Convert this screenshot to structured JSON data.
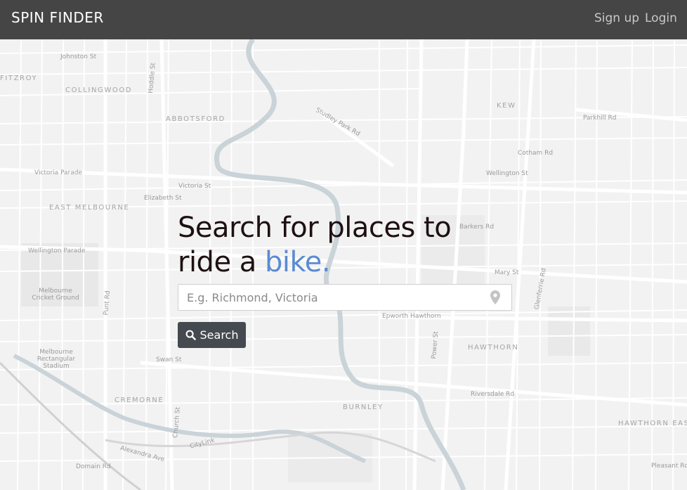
{
  "navbar": {
    "brand": "SPIN FINDER",
    "links": {
      "signup": "Sign up",
      "login": "Login"
    }
  },
  "hero": {
    "headline_part1": "Search for places to",
    "headline_part2": "ride a ",
    "headline_accent": "bike.",
    "search": {
      "placeholder": "E.g. Richmond, Victoria",
      "value": ""
    },
    "button_label": "Search"
  },
  "colors": {
    "navbar": "#454545",
    "accent": "#5b8bd0",
    "button": "#454a50",
    "headline": "#1e1012"
  },
  "icons": {
    "location": "map-marker-icon",
    "search": "magnifier-icon"
  },
  "map_labels": {
    "areas": [
      "FITZROY",
      "COLLINGWOOD",
      "ABBOTSFORD",
      "EAST MELBOURNE",
      "KEW",
      "HAWTHORN",
      "CREMORNE",
      "BURNLEY",
      "HAWTHORN EAST"
    ],
    "streets": [
      "Victoria Parade",
      "Victoria St",
      "Elizabeth St",
      "Wellington Parade",
      "Swan St",
      "Johnston St",
      "Studley Park Rd",
      "Barkers Rd",
      "Cotham Rd",
      "Parkhill Rd",
      "Riversdale Rd",
      "Glenferrie Rd",
      "Punt Rd",
      "Church St",
      "Hoddle St",
      "Wellington St",
      "Mary St",
      "Power St",
      "Epworth Hawthorn",
      "Domain Rd",
      "Alexandra Ave",
      "CityLink",
      "Pleasant Rd",
      "Melbourne Cricket Ground",
      "Melbourne Rectangular Stadium"
    ]
  }
}
